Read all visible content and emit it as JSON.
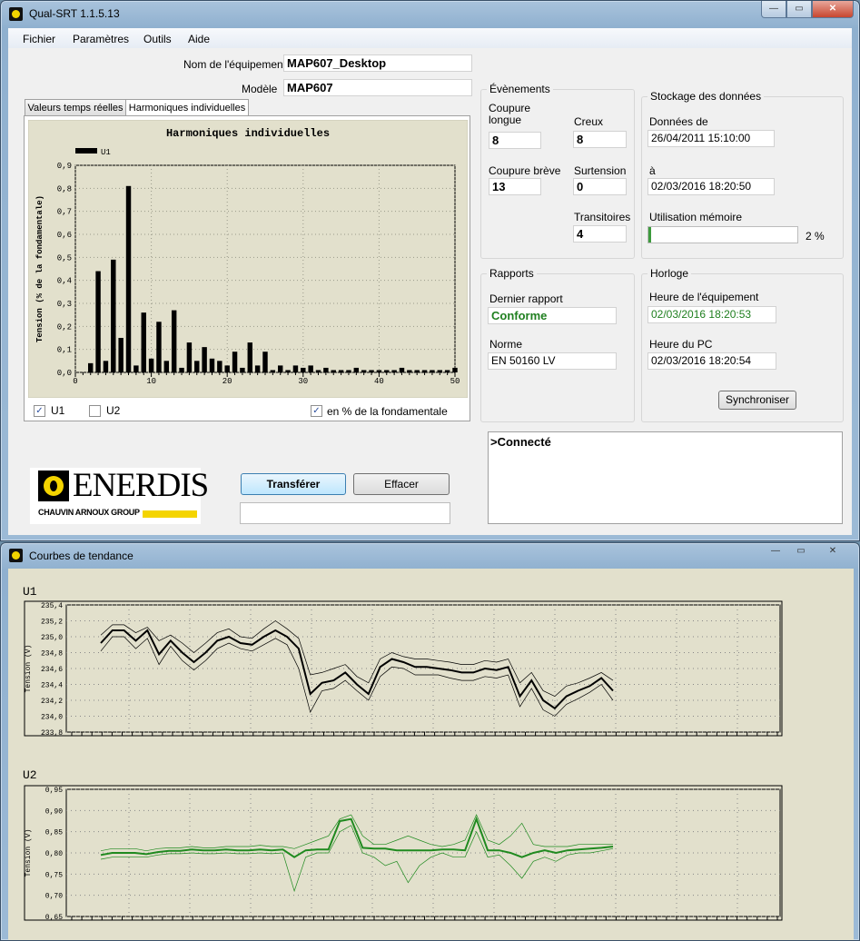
{
  "main_window": {
    "title": "Qual-SRT 1.1.5.13",
    "controls": {
      "minimize": "—",
      "maximize": "▭",
      "close": "✕"
    }
  },
  "menu": [
    "Fichier",
    "Paramètres",
    "Outils",
    "Aide"
  ],
  "equipment": {
    "name_label": "Nom de l'équipement",
    "name_value": "MAP607_Desktop",
    "model_label": "Modèle",
    "model_value": "MAP607"
  },
  "tabs": [
    "Valeurs temps réelles",
    "Harmoniques individuelles"
  ],
  "harmonics_panel": {
    "checkbox_u1": "U1",
    "checkbox_u2": "U2",
    "checkbox_percent": "en % de la fondamentale",
    "u1_checked": true,
    "u2_checked": false,
    "percent_checked": true
  },
  "events": {
    "title": "Évènements",
    "coupure_longue_label": "Coupure longue",
    "coupure_longue_value": "8",
    "creux_label": "Creux",
    "creux_value": "8",
    "coupure_breve_label": "Coupure brève",
    "coupure_breve_value": "13",
    "surtension_label": "Surtension",
    "surtension_value": "0",
    "transitoires_label": "Transitoires",
    "transitoires_value": "4"
  },
  "storage": {
    "title": "Stockage des données",
    "from_label": "Données de",
    "from_value": "26/04/2011 15:10:00",
    "to_label": "à",
    "to_value": "02/03/2016 18:20:50",
    "memory_label": "Utilisation mémoire",
    "memory_percent": 2,
    "memory_text": "2 %"
  },
  "reports": {
    "title": "Rapports",
    "last_label": "Dernier rapport",
    "last_value": "Conforme",
    "norm_label": "Norme",
    "norm_value": "EN 50160 LV"
  },
  "clock": {
    "title": "Horloge",
    "device_label": "Heure de l'équipement",
    "device_value": "02/03/2016 18:20:53",
    "pc_label": "Heure du PC",
    "pc_value": "02/03/2016 18:20:54",
    "sync_button": "Synchroniser"
  },
  "console": {
    "text": ">Connecté"
  },
  "buttons": {
    "transfer": "Transférer",
    "clear": "Effacer"
  },
  "logo": {
    "brand": "ENERDIS",
    "group": "CHAUVIN ARNOUX GROUP"
  },
  "colors": {
    "accent_green": "#1f7f1f",
    "plot_bg": "#e2e0cc",
    "memory_bar": "#3c9a3c"
  },
  "trend_window": {
    "title": "Courbes de tendance",
    "controls": {
      "minimize": "—",
      "maximize": "▭",
      "close": "✕"
    }
  },
  "chart_data": [
    {
      "type": "bar",
      "title": "Harmoniques individuelles",
      "legend": [
        "U1"
      ],
      "ylabel": "Tension (% de la fondamentale)",
      "xlim": [
        0,
        50
      ],
      "ylim": [
        0,
        0.9
      ],
      "xticks": [
        "0",
        "10",
        "20",
        "30",
        "40",
        "50"
      ],
      "yticks": [
        "0,0",
        "0,1",
        "0,2",
        "0,3",
        "0,4",
        "0,5",
        "0,6",
        "0,7",
        "0,8",
        "0,9"
      ],
      "x": [
        2,
        3,
        4,
        5,
        6,
        7,
        8,
        9,
        10,
        11,
        12,
        13,
        14,
        15,
        16,
        17,
        18,
        19,
        20,
        21,
        22,
        23,
        24,
        25,
        26,
        27,
        28,
        29,
        30,
        31,
        32,
        33,
        34,
        35,
        36,
        37,
        38,
        39,
        40,
        41,
        42,
        43,
        44,
        45,
        46,
        47,
        48,
        49,
        50
      ],
      "values": [
        0.04,
        0.44,
        0.05,
        0.49,
        0.15,
        0.81,
        0.03,
        0.26,
        0.06,
        0.22,
        0.05,
        0.27,
        0.02,
        0.13,
        0.05,
        0.11,
        0.06,
        0.05,
        0.03,
        0.09,
        0.02,
        0.13,
        0.03,
        0.09,
        0.01,
        0.03,
        0.01,
        0.03,
        0.02,
        0.03,
        0.01,
        0.02,
        0.01,
        0.01,
        0.01,
        0.02,
        0.01,
        0.01,
        0.01,
        0.01,
        0.01,
        0.02,
        0.01,
        0.01,
        0.01,
        0.01,
        0.01,
        0.01,
        0.02
      ]
    },
    {
      "type": "line",
      "title": "U1",
      "ylabel": "Tension (V)",
      "ylim": [
        233.8,
        235.4
      ],
      "yticks": [
        "233,8",
        "234,0",
        "234,2",
        "234,4",
        "234,6",
        "234,8",
        "235,0",
        "235,2",
        "235,4"
      ],
      "series": [
        {
          "values": [
            234.92,
            235.08,
            235.08,
            234.95,
            235.08,
            234.78,
            234.95,
            234.8,
            234.68,
            234.8,
            234.95,
            235.0,
            234.92,
            234.9,
            235.0,
            235.08,
            235.0,
            234.85,
            234.28,
            234.42,
            234.45,
            234.55,
            234.4,
            234.28,
            234.62,
            234.72,
            234.68,
            234.62,
            234.62,
            234.6,
            234.58,
            234.55,
            234.55,
            234.6,
            234.58,
            234.62,
            234.25,
            234.45,
            234.2,
            234.1,
            234.25,
            234.32,
            234.38,
            234.48,
            234.32
          ]
        },
        {
          "values": [
            235.02,
            235.15,
            235.15,
            235.05,
            235.12,
            234.95,
            235.02,
            234.92,
            234.8,
            234.92,
            235.05,
            235.1,
            235.0,
            234.98,
            235.1,
            235.2,
            235.1,
            234.98,
            234.52,
            234.55,
            234.6,
            234.65,
            234.5,
            234.42,
            234.72,
            234.8,
            234.75,
            234.72,
            234.72,
            234.7,
            234.68,
            234.65,
            234.65,
            234.7,
            234.68,
            234.72,
            234.42,
            234.55,
            234.32,
            234.25,
            234.38,
            234.42,
            234.48,
            234.55,
            234.45
          ]
        },
        {
          "values": [
            234.82,
            235.0,
            235.0,
            234.85,
            234.98,
            234.65,
            234.88,
            234.7,
            234.58,
            234.7,
            234.85,
            234.92,
            234.85,
            234.82,
            234.9,
            234.98,
            234.9,
            234.6,
            234.05,
            234.32,
            234.35,
            234.45,
            234.32,
            234.2,
            234.5,
            234.62,
            234.6,
            234.52,
            234.52,
            234.52,
            234.48,
            234.45,
            234.45,
            234.5,
            234.48,
            234.52,
            234.12,
            234.35,
            234.08,
            234.0,
            234.15,
            234.22,
            234.3,
            234.4,
            234.2
          ]
        }
      ]
    },
    {
      "type": "line",
      "title": "U2",
      "ylabel": "Tension (V)",
      "ylim": [
        0.65,
        0.95
      ],
      "yticks": [
        "0,65",
        "0,70",
        "0,75",
        "0,80",
        "0,85",
        "0,90",
        "0,95"
      ],
      "series": [
        {
          "values": [
            0.795,
            0.8,
            0.8,
            0.8,
            0.797,
            0.802,
            0.805,
            0.805,
            0.808,
            0.806,
            0.806,
            0.808,
            0.806,
            0.806,
            0.808,
            0.806,
            0.808,
            0.79,
            0.806,
            0.808,
            0.808,
            0.875,
            0.88,
            0.812,
            0.81,
            0.81,
            0.806,
            0.806,
            0.806,
            0.806,
            0.808,
            0.808,
            0.806,
            0.88,
            0.806,
            0.806,
            0.8,
            0.79,
            0.8,
            0.806,
            0.8,
            0.806,
            0.808,
            0.81,
            0.812,
            0.815
          ]
        },
        {
          "values": [
            0.805,
            0.81,
            0.81,
            0.81,
            0.805,
            0.81,
            0.812,
            0.812,
            0.815,
            0.812,
            0.812,
            0.815,
            0.815,
            0.815,
            0.818,
            0.815,
            0.815,
            0.81,
            0.82,
            0.83,
            0.84,
            0.88,
            0.89,
            0.84,
            0.82,
            0.82,
            0.83,
            0.84,
            0.83,
            0.82,
            0.815,
            0.82,
            0.83,
            0.89,
            0.83,
            0.82,
            0.84,
            0.87,
            0.82,
            0.815,
            0.815,
            0.815,
            0.82,
            0.82,
            0.82,
            0.82
          ]
        },
        {
          "values": [
            0.785,
            0.79,
            0.79,
            0.79,
            0.79,
            0.795,
            0.798,
            0.798,
            0.8,
            0.798,
            0.798,
            0.8,
            0.798,
            0.798,
            0.8,
            0.798,
            0.8,
            0.71,
            0.79,
            0.8,
            0.8,
            0.85,
            0.865,
            0.8,
            0.79,
            0.77,
            0.78,
            0.73,
            0.77,
            0.79,
            0.8,
            0.79,
            0.79,
            0.85,
            0.79,
            0.795,
            0.77,
            0.74,
            0.78,
            0.79,
            0.78,
            0.795,
            0.8,
            0.8,
            0.805,
            0.81
          ]
        }
      ]
    }
  ]
}
